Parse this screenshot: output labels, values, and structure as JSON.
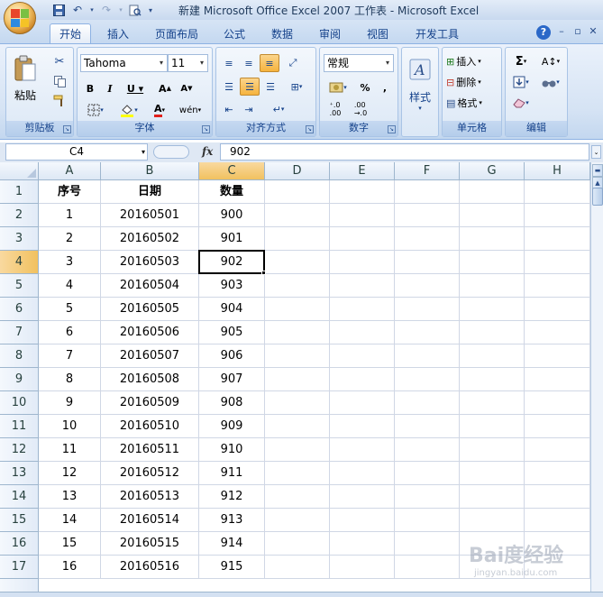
{
  "window": {
    "title": "新建 Microsoft Office Excel 2007 工作表 - Microsoft Excel"
  },
  "ribbon": {
    "tabs": [
      "开始",
      "插入",
      "页面布局",
      "公式",
      "数据",
      "审阅",
      "视图",
      "开发工具"
    ],
    "active_tab": "开始",
    "groups": {
      "clipboard": {
        "label": "剪贴板",
        "paste_label": "粘贴"
      },
      "font": {
        "label": "字体",
        "font_name": "Tahoma",
        "font_size": "11"
      },
      "alignment": {
        "label": "对齐方式"
      },
      "number": {
        "label": "数字",
        "format": "常规"
      },
      "styles": {
        "label": "样式"
      },
      "cells": {
        "label": "单元格",
        "insert": "插入",
        "delete": "删除",
        "format": "格式"
      },
      "editing": {
        "label": "编辑"
      }
    }
  },
  "formula_bar": {
    "name_box": "C4",
    "fx_label": "fx",
    "value": "902"
  },
  "sheet": {
    "columns": [
      "A",
      "B",
      "C",
      "D",
      "E",
      "F",
      "G",
      "H"
    ],
    "selected_column": "C",
    "selected_row": "4",
    "header_row": [
      "序号",
      "日期",
      "数量"
    ],
    "rows": [
      {
        "n": "2",
        "a": "1",
        "b": "20160501",
        "c": "900"
      },
      {
        "n": "3",
        "a": "2",
        "b": "20160502",
        "c": "901"
      },
      {
        "n": "4",
        "a": "3",
        "b": "20160503",
        "c": "902"
      },
      {
        "n": "5",
        "a": "4",
        "b": "20160504",
        "c": "903"
      },
      {
        "n": "6",
        "a": "5",
        "b": "20160505",
        "c": "904"
      },
      {
        "n": "7",
        "a": "6",
        "b": "20160506",
        "c": "905"
      },
      {
        "n": "8",
        "a": "7",
        "b": "20160507",
        "c": "906"
      },
      {
        "n": "9",
        "a": "8",
        "b": "20160508",
        "c": "907"
      },
      {
        "n": "10",
        "a": "9",
        "b": "20160509",
        "c": "908"
      },
      {
        "n": "11",
        "a": "10",
        "b": "20160510",
        "c": "909"
      },
      {
        "n": "12",
        "a": "11",
        "b": "20160511",
        "c": "910"
      },
      {
        "n": "13",
        "a": "12",
        "b": "20160512",
        "c": "911"
      },
      {
        "n": "14",
        "a": "13",
        "b": "20160513",
        "c": "912"
      },
      {
        "n": "15",
        "a": "14",
        "b": "20160514",
        "c": "913"
      },
      {
        "n": "16",
        "a": "15",
        "b": "20160515",
        "c": "914"
      },
      {
        "n": "17",
        "a": "16",
        "b": "20160516",
        "c": "915"
      }
    ]
  },
  "watermark": {
    "main": "Bai度经验",
    "sub": "jingyan.baidu.com"
  },
  "colors": {
    "accent": "#f6b33e",
    "ribbon_text": "#15428b",
    "gridline": "#d0d7e5"
  }
}
